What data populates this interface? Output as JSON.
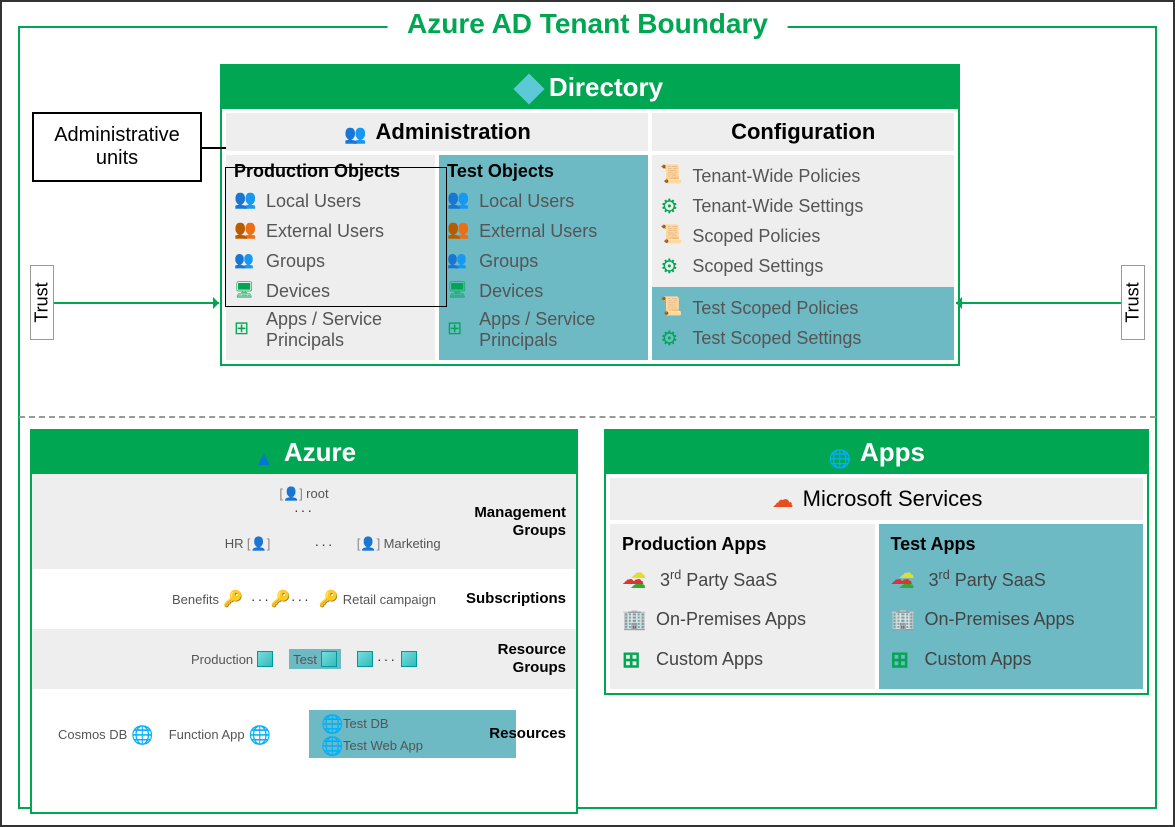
{
  "title": "Azure AD Tenant Boundary",
  "adminUnitsLabel": "Administrative units",
  "trustLabel": "Trust",
  "directory": {
    "title": "Directory",
    "adminHeader": "Administration",
    "configHeader": "Configuration",
    "productionTitle": "Production Objects",
    "testTitle": "Test Objects",
    "objects": [
      "Local Users",
      "External Users",
      "Groups",
      "Devices",
      "Apps / Service Principals"
    ],
    "configItems": [
      "Tenant-Wide Policies",
      "Tenant-Wide Settings",
      "Scoped Policies",
      "Scoped Settings"
    ],
    "testConfigItems": [
      "Test Scoped Policies",
      "Test Scoped Settings"
    ]
  },
  "azure": {
    "title": "Azure",
    "tiers": [
      "Management Groups",
      "Subscriptions",
      "Resource Groups",
      "Resources"
    ],
    "mgmt": {
      "root": "root",
      "hr": "HR",
      "marketing": "Marketing"
    },
    "subs": {
      "benefits": "Benefits",
      "retail": "Retail campaign"
    },
    "rg": {
      "production": "Production",
      "test": "Test"
    },
    "resources": {
      "cosmos": "Cosmos DB",
      "function": "Function App",
      "testdb": "Test DB",
      "testweb": "Test Web App"
    }
  },
  "apps": {
    "title": "Apps",
    "msServices": "Microsoft Services",
    "prodTitle": "Production Apps",
    "testTitle": "Test Apps",
    "items": [
      {
        "label": "3rd Party SaaS",
        "icon": "multi-cloud",
        "sup": "rd",
        "pre": "3"
      },
      {
        "label": "On-Premises Apps",
        "icon": "building"
      },
      {
        "label": "Custom Apps",
        "icon": "grid"
      }
    ]
  }
}
